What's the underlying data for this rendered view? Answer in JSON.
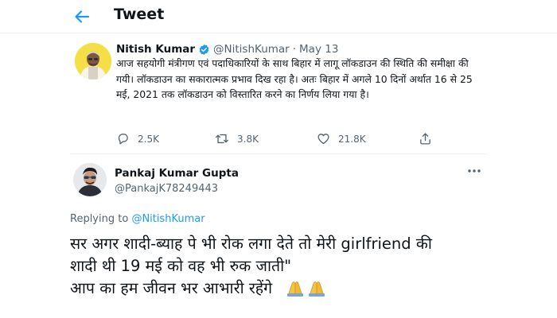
{
  "header": {
    "title": "Tweet"
  },
  "tweet": {
    "author_name": "Nitish Kumar",
    "author_handle": "@NitishKumar",
    "separator": "·",
    "date": "May 13",
    "text": "आज सहयोगी मंत्रीगण एवं पदाधिकारियों के साथ बिहार में लागू लॉकडाउन की स्थिति की समीक्षा की गयी। लॉकडाउन का सकारात्मक प्रभाव दिख रहा है। अतः बिहार में अगले 10 दिनों अर्थात 16 से 25 मई, 2021 तक लॉकडाउन को विस्तारित करने का निर्णय लिया गया है।",
    "stats": {
      "replies": "2.5K",
      "retweets": "3.8K",
      "likes": "21.8K"
    }
  },
  "reply": {
    "author_name": "Pankaj Kumar Gupta",
    "author_handle": "@PankajK78249443",
    "replying_prefix": "Replying to",
    "replying_to": "@NitishKumar",
    "text_line1": "सर अगर शादी-ब्याह पे भी रोक लगा देते तो मेरी girlfriend की",
    "text_line2": "शादी थी 19 मई को वह भी रुक जाती\"",
    "text_line3": "आप का हम जीवन भर आभारी रहेंगे"
  },
  "colors": {
    "accent": "#1d9bf0",
    "muted": "#536471",
    "text": "#0f1419",
    "divider": "#eff3f4"
  },
  "icons": [
    "back-arrow-icon",
    "verified-badge-icon",
    "reply-icon",
    "retweet-icon",
    "like-icon",
    "share-icon",
    "more-icon",
    "folded-hands-emoji"
  ]
}
